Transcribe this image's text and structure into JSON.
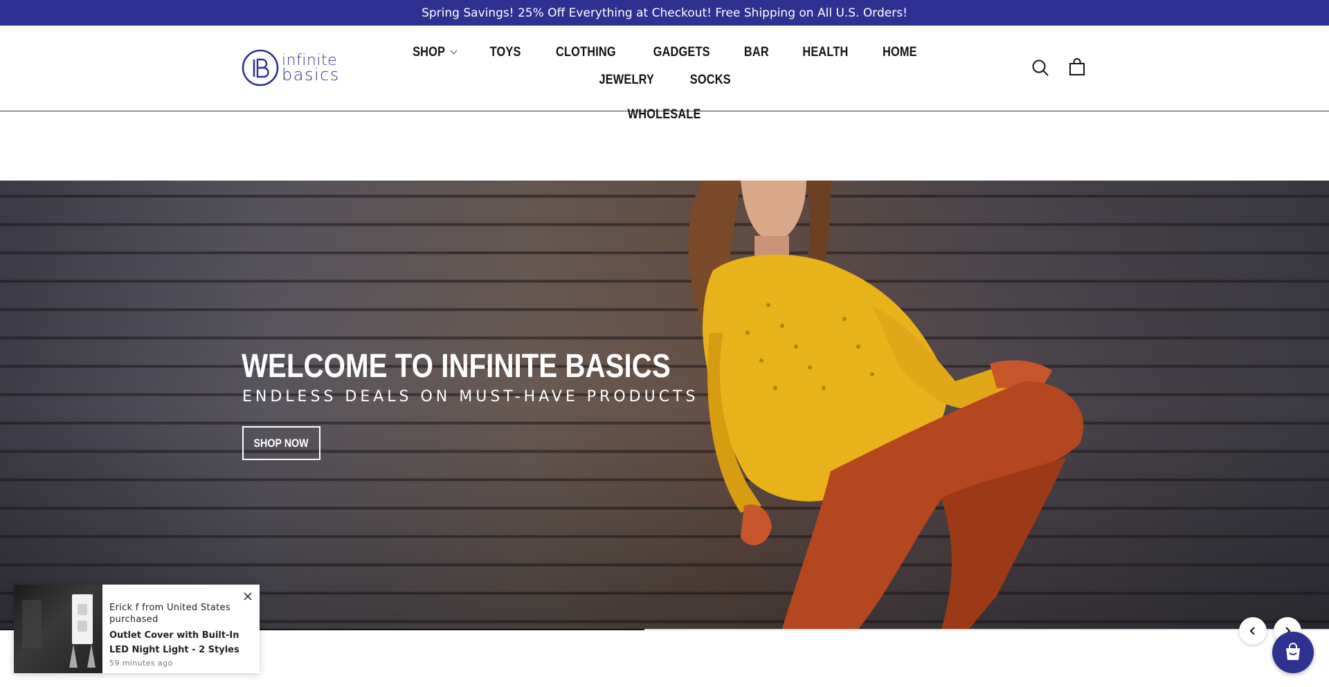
{
  "announcement": {
    "text": "Spring Savings! 25% Off Everything at Checkout! Free Shipping on All U.S. Orders!"
  },
  "logo": {
    "line1": "infinite",
    "line2": "basics",
    "color": "#2e3192"
  },
  "nav": {
    "items": [
      {
        "label": "SHOP",
        "has_dropdown": true
      },
      {
        "label": "TOYS"
      },
      {
        "label": "CLOTHING"
      },
      {
        "label": "GADGETS"
      },
      {
        "label": "BAR"
      },
      {
        "label": "HEALTH"
      },
      {
        "label": "HOME"
      },
      {
        "label": "JEWELRY"
      },
      {
        "label": "SOCKS"
      },
      {
        "label": "WHOLESALE"
      }
    ]
  },
  "header_icons": {
    "search": "search-icon",
    "cart": "cart-icon"
  },
  "hero": {
    "title": "WELCOME TO INFINITE BASICS",
    "subtitle": "ENDLESS DEALS ON MUST-HAVE PRODUCTS",
    "button": "SHOP NOW",
    "progress": 0.485
  },
  "slideshow": {
    "prev_icon": "chevron-left-icon",
    "next_icon": "chevron-right-icon"
  },
  "sales_popup": {
    "line1": "Erick f from United States purchased",
    "product": "Outlet Cover with Built-In LED Night Light - 2 Styles",
    "time": "59 minutes ago"
  },
  "colors": {
    "brand": "#2e3192",
    "announcement_bg": "#2e3192"
  }
}
